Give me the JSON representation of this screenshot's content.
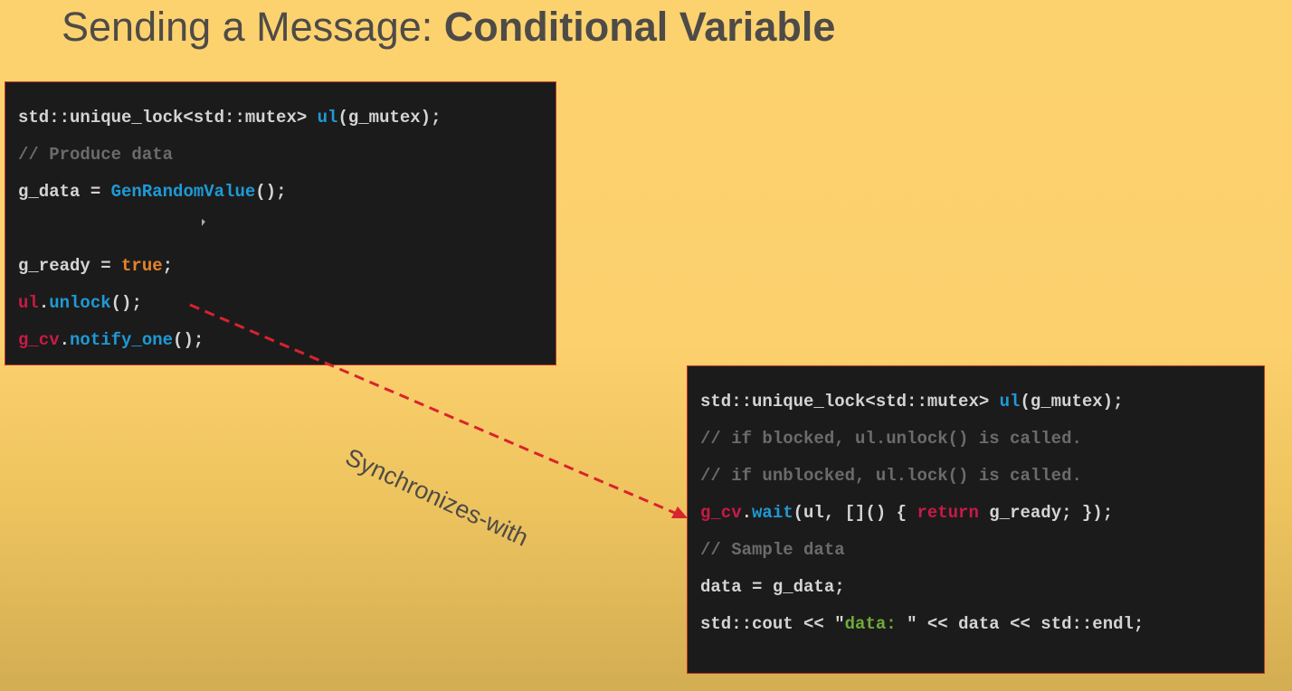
{
  "slide": {
    "title_prefix": "Sending a Message: ",
    "title_bold": "Conditional Variable",
    "sync_label": "Synchronizes-with"
  },
  "producer": {
    "line1": {
      "a": "std::unique_lock<std::mutex> ",
      "b": "ul",
      "c": "(g_mutex);"
    },
    "line2": "// Produce data",
    "line3": {
      "a": "g_data = ",
      "b": "GenRandomValue",
      "c": "();"
    },
    "line4": {
      "a": "g_ready = ",
      "b": "true",
      "c": ";"
    },
    "line5": {
      "a": "ul",
      "b": ".",
      "c": "unlock",
      "d": "();"
    },
    "line6": {
      "a": "g_cv",
      "b": ".",
      "c": "notify_one",
      "d": "();"
    }
  },
  "consumer": {
    "line1": {
      "a": "std::unique_lock<std::mutex> ",
      "b": "ul",
      "c": "(g_mutex);"
    },
    "line2": "// if blocked, ul.unlock() is called.",
    "line3": "// if unblocked, ul.lock() is called.",
    "line4": {
      "a": "g_cv",
      "b": ".",
      "c": "wait",
      "d": "(ul, []() { ",
      "e": "return",
      "f": " g_ready; });"
    },
    "line5": "// Sample data",
    "line6": "data = g_data;",
    "line7": {
      "a": "std::cout << \"",
      "b": "data: ",
      "c": "\" << data << std::endl;"
    }
  },
  "colors": {
    "background": "#fcd26f",
    "code_bg": "#1c1b1b",
    "border": "#c0392b",
    "arrow": "#d9232e",
    "comment": "#6b6b6b",
    "function": "#1e9ad6",
    "variable_red": "#c71b45",
    "literal_orange": "#e8832a",
    "string_green": "#6faa3a"
  }
}
